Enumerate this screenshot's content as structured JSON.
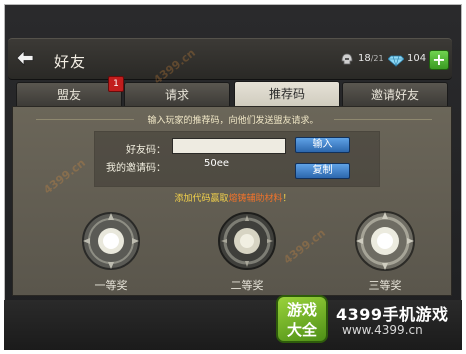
{
  "header": {
    "title": "好友",
    "helmet_count": "18",
    "helmet_max": "/21",
    "gem_count": "104"
  },
  "tabs": [
    {
      "label": "盟友",
      "badge": "1"
    },
    {
      "label": "请求"
    },
    {
      "label": "推荐码",
      "active": true
    },
    {
      "label": "邀请好友"
    }
  ],
  "panel": {
    "hint": "输入玩家的推荐码，向他们发送盟友请求。",
    "friend_code_label": "好友码：",
    "friend_code_value": "",
    "my_code_label": "我的邀请码：",
    "my_code_value": "50ee",
    "input_button": "输入",
    "copy_button": "复制",
    "reward_text_prefix": "添加代码赢取",
    "reward_text_highlight": "熔铸辅助材料",
    "reward_text_suffix": "！"
  },
  "prizes": [
    {
      "label": "一等奖"
    },
    {
      "label": "二等奖"
    },
    {
      "label": "三等奖"
    }
  ],
  "brand": {
    "logo_line1": "游戏",
    "logo_line2": "大全",
    "name": "4399手机游戏",
    "url": "www.4399.cn"
  },
  "watermark": "4399.cn",
  "colors": {
    "accent_blue": "#3b7ccc",
    "reward_yellow": "#f3d24b",
    "reward_orange": "#f0732b",
    "badge_red": "#c21d1d",
    "plus_green": "#4fb52f"
  }
}
